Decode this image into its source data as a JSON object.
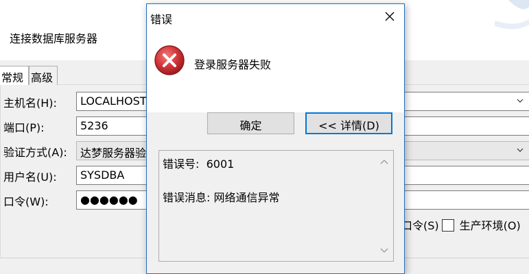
{
  "background_window": {
    "header_title": "连接数据库服务器",
    "tabs": [
      {
        "label": "常规",
        "active": true
      },
      {
        "label": "高级",
        "active": false
      }
    ],
    "form": {
      "host_label": "主机名(H):",
      "host_value": "LOCALHOST",
      "port_label": "端口(P):",
      "port_value": "5236",
      "auth_label": "验证方式(A):",
      "auth_value": "达梦服务器验",
      "user_label": "用户名(U):",
      "user_value": "SYSDBA",
      "password_label": "口令(W):",
      "password_value": "●●●●●●",
      "save_password_label": "口令(S)",
      "production_env_label": "生产环境(O)"
    }
  },
  "error_dialog": {
    "title": "错误",
    "message": "登录服务器失败",
    "ok_label": "确定",
    "details_label": "<< 详情(D)",
    "details": {
      "error_code_label": "错误号:",
      "error_code": "6001",
      "error_message_line": "错误消息: 网络通信异常"
    }
  },
  "colors": {
    "dialog_border": "#1e6fbf",
    "error_red": "#d13438",
    "focus_blue": "#0078d7"
  }
}
